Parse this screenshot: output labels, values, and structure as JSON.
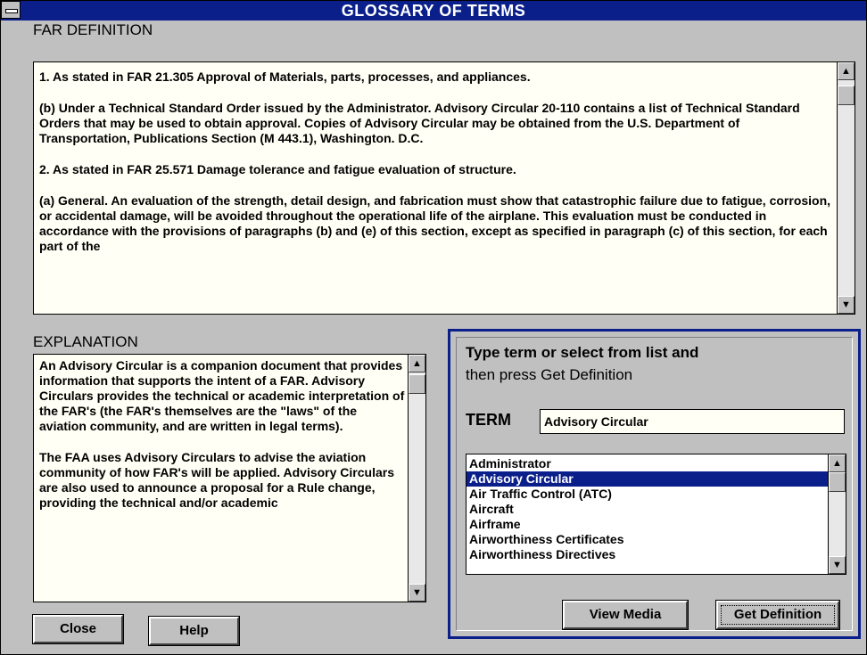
{
  "window": {
    "title": "GLOSSARY OF TERMS"
  },
  "far": {
    "heading": "FAR DEFINITION",
    "paragraphs": [
      "1. As stated in FAR 21.305 Approval of Materials, parts, processes, and appliances.",
      "(b) Under a Technical Standard Order issued by the Administrator. Advisory Circular 20-110 contains a list of Technical Standard Orders that may be used to obtain approval. Copies of Advisory Circular may be obtained from the U.S. Department of Transportation, Publications Section (M 443.1), Washington. D.C.",
      "2. As stated in FAR 25.571 Damage tolerance and fatigue evaluation of structure.",
      "(a) General. An evaluation of the strength, detail design, and fabrication must show that catastrophic failure due to fatigue, corrosion, or accidental damage, will be avoided throughout the operational life of the airplane. This evaluation must be conducted in accordance with the provisions of paragraphs (b) and (e) of this section, except as specified in paragraph (c) of this section, for each part of the"
    ]
  },
  "explanation": {
    "heading": "EXPLANATION",
    "paragraphs": [
      "An Advisory Circular is a companion document that provides information that supports the intent of a FAR. Advisory Circulars provides the technical or academic interpretation of the FAR's (the FAR's themselves are the \"laws\" of the aviation community, and are written in legal terms).",
      "The FAA uses Advisory Circulars to advise the aviation community of how FAR's will be applied. Advisory Circulars are also used to announce a proposal for a Rule change, providing the technical and/or academic"
    ]
  },
  "lookup": {
    "instruction_line1": "Type term or select from list and",
    "instruction_line2": "then press Get Definition",
    "term_label": "TERM",
    "term_value": "Advisory Circular",
    "items": [
      "Administrator",
      "Advisory Circular",
      "Air Traffic Control (ATC)",
      "Aircraft",
      "Airframe",
      "Airworthiness Certificates",
      "Airworthiness Directives"
    ],
    "selected_index": 1,
    "view_media_label": "View Media",
    "get_definition_label": "Get Definition"
  },
  "buttons": {
    "close_label": "Close",
    "help_label": "Help"
  },
  "icons": {
    "scroll_up": "up-arrow-icon",
    "scroll_down": "down-arrow-icon",
    "system_menu": "system-menu-icon"
  },
  "colors": {
    "title_bar": "#0a1f8a",
    "selection": "#0a1f8a",
    "text_background": "#fffff5"
  }
}
